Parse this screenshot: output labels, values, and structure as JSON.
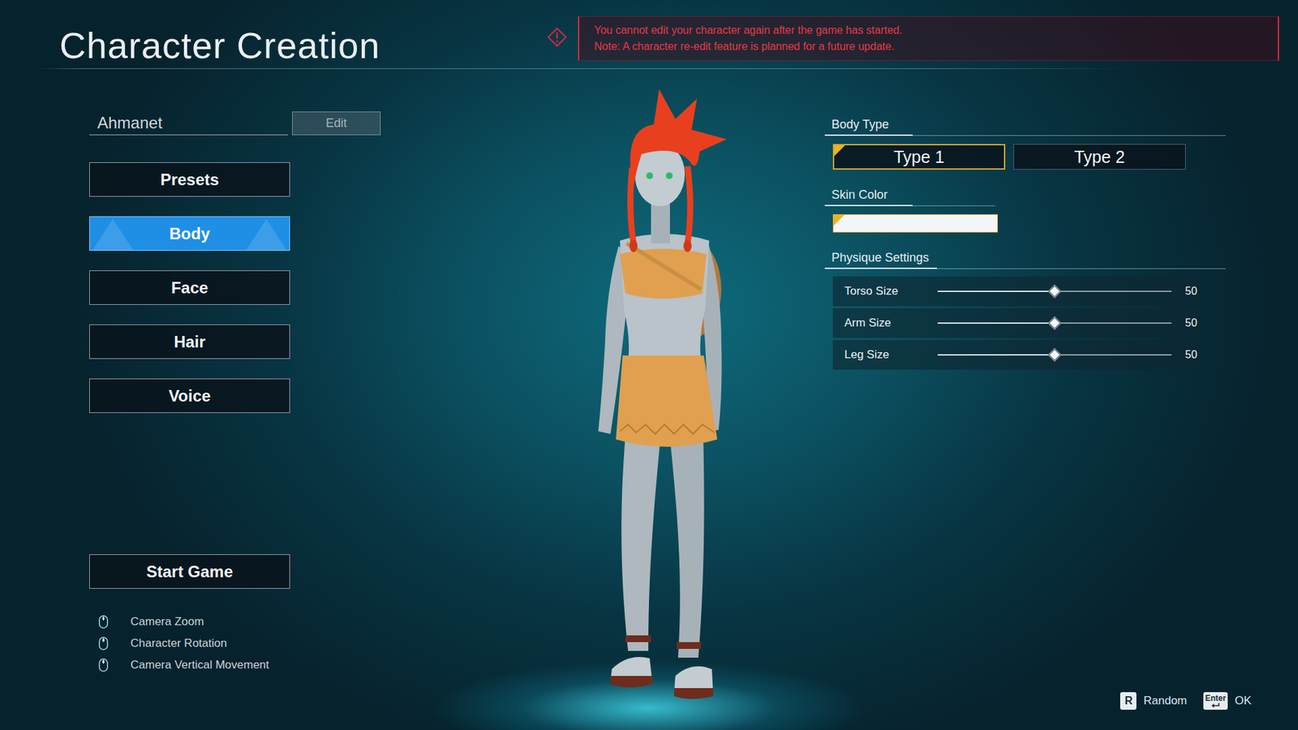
{
  "title": "Character Creation",
  "warning": {
    "lines": [
      "You cannot edit your character again after the game has started.",
      "Note: A character re-edit feature is planned for a future update."
    ]
  },
  "name_field": {
    "value": "Ahmanet",
    "button": "Edit"
  },
  "menu": [
    {
      "label": "Presets",
      "selected": false
    },
    {
      "label": "Body",
      "selected": true
    },
    {
      "label": "Face",
      "selected": false
    },
    {
      "label": "Hair",
      "selected": false
    },
    {
      "label": "Voice",
      "selected": false
    }
  ],
  "start_button": "Start Game",
  "controls": [
    {
      "label": "Camera Zoom"
    },
    {
      "label": "Character Rotation"
    },
    {
      "label": "Camera Vertical Movement"
    }
  ],
  "body_type": {
    "heading": "Body Type",
    "options": [
      {
        "label": "Type 1",
        "selected": true
      },
      {
        "label": "Type 2",
        "selected": false
      }
    ]
  },
  "skin_color": {
    "heading": "Skin Color",
    "color": "#f3f6f8"
  },
  "physique": {
    "heading": "Physique Settings",
    "sliders": [
      {
        "label": "Torso Size",
        "level": 0.5,
        "reading": "50"
      },
      {
        "label": "Arm Size",
        "level": 0.5,
        "reading": "50"
      },
      {
        "label": "Leg Size",
        "level": 0.5,
        "reading": "50"
      }
    ]
  },
  "keys": [
    {
      "key": "R",
      "label": "Random"
    },
    {
      "key": "Enter",
      "label": "OK"
    }
  ]
}
